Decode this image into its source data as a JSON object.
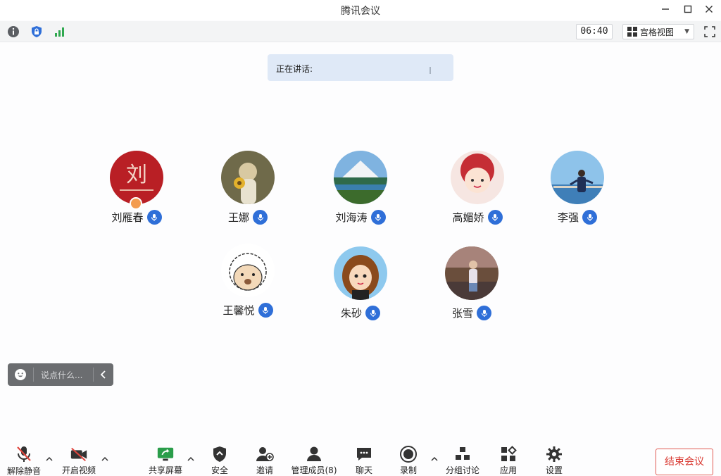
{
  "window": {
    "title": "腾讯会议"
  },
  "topbar": {
    "timer": "06:40",
    "view_label": "宫格视图"
  },
  "speaking": {
    "label": "正在讲话:"
  },
  "participants": [
    {
      "name": "刘雁春"
    },
    {
      "name": "王娜"
    },
    {
      "name": "刘海涛"
    },
    {
      "name": "高媚娇"
    },
    {
      "name": "李强"
    },
    {
      "name": "王馨悦"
    },
    {
      "name": "朱砂"
    },
    {
      "name": "张雪"
    }
  ],
  "chat": {
    "placeholder": "说点什么..."
  },
  "toolbar": {
    "unmute": "解除静音",
    "start_video": "开启视频",
    "share_screen": "共享屏幕",
    "security": "安全",
    "invite": "邀请",
    "manage_members": "管理成员(8)",
    "chat": "聊天",
    "record": "录制",
    "breakout": "分组讨论",
    "apps": "应用",
    "settings": "设置",
    "end_meeting": "结束会议"
  },
  "colors": {
    "accent_blue": "#2f6fd8",
    "end_red": "#d93a32",
    "speaking_bg": "#dfe9f7"
  }
}
